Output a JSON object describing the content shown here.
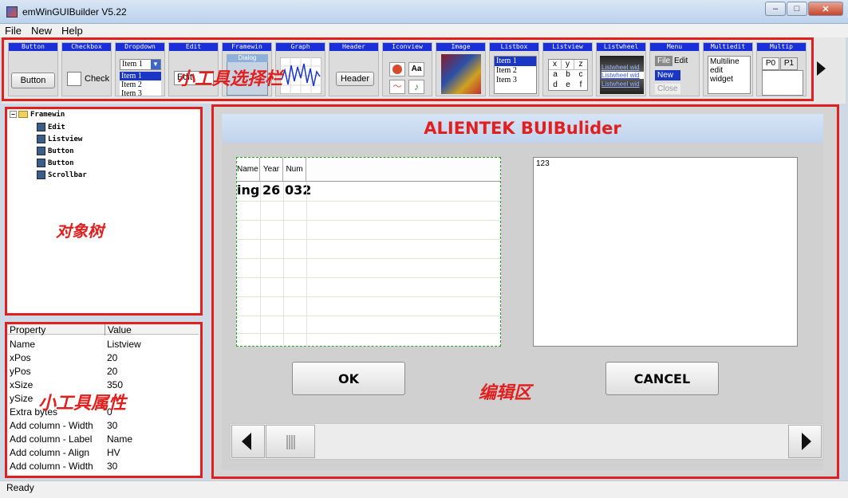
{
  "window": {
    "title": "emWinGUIBuilder V5.22",
    "minimize": "–",
    "maximize": "□",
    "close": "✕"
  },
  "menu": [
    "File",
    "New",
    "Help"
  ],
  "toolbar": {
    "tools": [
      "Button",
      "Checkbox",
      "Dropdown",
      "Edit",
      "Framewin",
      "Graph",
      "Header",
      "Iconview",
      "Image",
      "Listbox",
      "Listview",
      "Listwheel",
      "Menu",
      "Multiedit",
      "Multip"
    ],
    "button_label": "Button",
    "checkbox_label": "Check",
    "dropdown_selected": "Item 1",
    "dropdown_items": [
      "Item 1",
      "Item 2",
      "Item 3"
    ],
    "edit_text": "Edit",
    "framewin_text": "Dialog",
    "header_label": "Header",
    "iconview_text": "Aa",
    "listbox_items": [
      "Item 1",
      "Item 2",
      "Item 3"
    ],
    "listview_cells": [
      "x",
      "y",
      "z",
      "a",
      "b",
      "c",
      "d",
      "e",
      "f"
    ],
    "listwheel_items": [
      "Listwheel wid",
      "Listwheel wid",
      "Listwheel wid"
    ],
    "menu_file": "File",
    "menu_edit": "Edit",
    "menu_new": "New",
    "menu_close": "Close",
    "multiedit_lines": [
      "Multiline",
      "edit",
      "widget"
    ],
    "multipage_tabs": [
      "P0",
      "P1"
    ]
  },
  "labels": {
    "toolbar": "小工具选择栏",
    "tree": "对象树",
    "props": "小工具属性",
    "editor": "编辑区"
  },
  "tree": {
    "root": "Framewin",
    "expander": "−",
    "children": [
      "Edit",
      "Listview",
      "Button",
      "Button",
      "Scrollbar"
    ]
  },
  "properties": {
    "header": {
      "property": "Property",
      "value": "Value"
    },
    "rows": [
      {
        "name": "Name",
        "value": "Listview"
      },
      {
        "name": "xPos",
        "value": "20"
      },
      {
        "name": "yPos",
        "value": "20"
      },
      {
        "name": "xSize",
        "value": "350"
      },
      {
        "name": "ySize",
        "value": ""
      },
      {
        "name": "Extra bytes",
        "value": "0"
      },
      {
        "name": "Add column - Width",
        "value": "30"
      },
      {
        "name": "Add column - Label",
        "value": "Name"
      },
      {
        "name": "Add column - Align",
        "value": "HV"
      },
      {
        "name": "Add column - Width",
        "value": "30"
      }
    ]
  },
  "editor": {
    "dialog_title": "ALIENTEK BUIBulider",
    "listview": {
      "columns": [
        "Name",
        "Year",
        "Num"
      ],
      "cells": [
        "ingS",
        "26",
        "032"
      ]
    },
    "edit_value": "123",
    "ok_label": "OK",
    "cancel_label": "CANCEL"
  },
  "status": "Ready"
}
